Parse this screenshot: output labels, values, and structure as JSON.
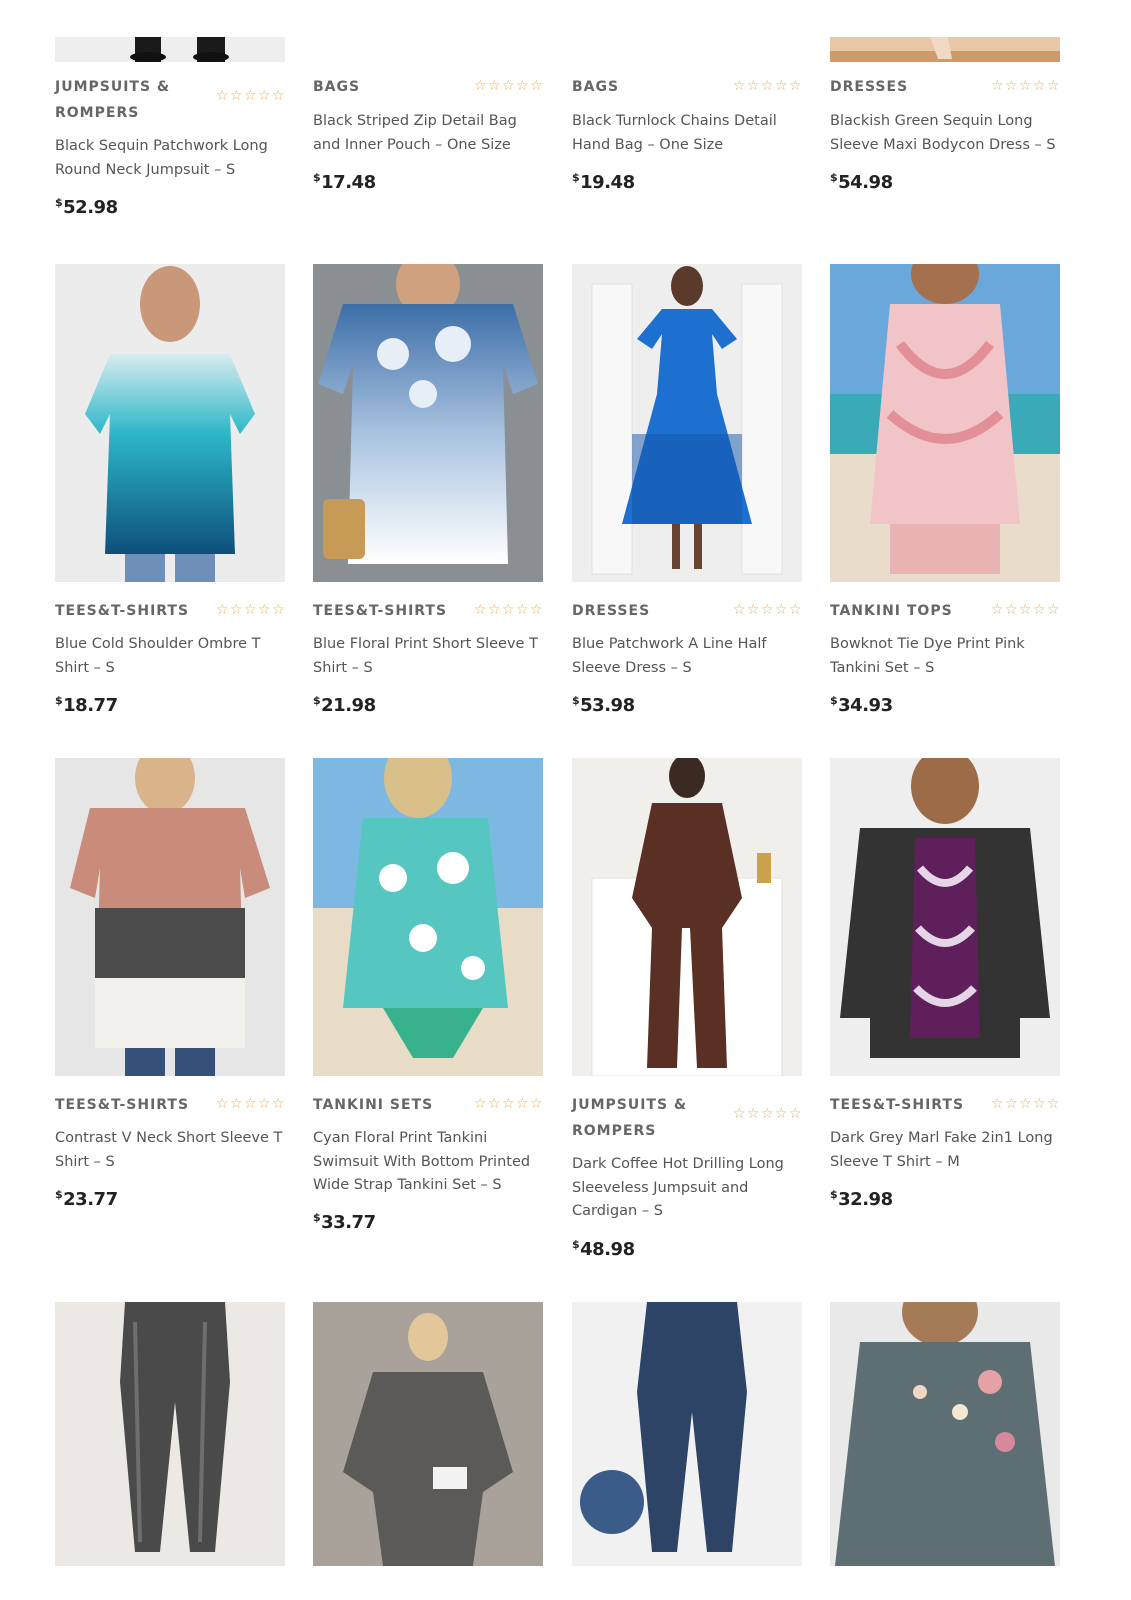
{
  "products": [
    {
      "category": "JUMPSUITS & ROMPERS",
      "title": "Black Sequin Patchwork Long Round Neck Jumpsuit – S",
      "currency": "$",
      "price": "52.98",
      "image": "black-jumpsuit-image",
      "image_color": "#2a2a2a"
    },
    {
      "category": "BAGS",
      "title": "Black Striped Zip Detail Bag and Inner Pouch – One Size",
      "currency": "$",
      "price": "17.48",
      "image": "",
      "image_color": "#ffffff"
    },
    {
      "category": "BAGS",
      "title": "Black Turnlock Chains Detail Hand Bag – One Size",
      "currency": "$",
      "price": "19.48",
      "image": "",
      "image_color": "#ffffff"
    },
    {
      "category": "DRESSES",
      "title": "Blackish Green Sequin Long Sleeve Maxi Bodycon Dress – S",
      "currency": "$",
      "price": "54.98",
      "image": "dress-photo-image",
      "image_color": "#d6a27a"
    },
    {
      "category": "TEES&T-SHIRTS",
      "title": "Blue Cold Shoulder Ombre T Shirt – S",
      "currency": "$",
      "price": "18.77",
      "image": "ombre-tshirt-image",
      "image_color": "#1f8fb0"
    },
    {
      "category": "TEES&T-SHIRTS",
      "title": "Blue Floral Print Short Sleeve T Shirt – S",
      "currency": "$",
      "price": "21.98",
      "image": "floral-tshirt-image",
      "image_color": "#4f79b0"
    },
    {
      "category": "DRESSES",
      "title": "Blue Patchwork A Line Half Sleeve Dress – S",
      "currency": "$",
      "price": "53.98",
      "image": "blue-dress-image",
      "image_color": "#1d6fd0"
    },
    {
      "category": "TANKINI TOPS",
      "title": "Bowknot Tie Dye Print Pink Tankini Set – S",
      "currency": "$",
      "price": "34.93",
      "image": "pink-tankini-image",
      "image_color": "#e8a3a8"
    },
    {
      "category": "TEES&T-SHIRTS",
      "title": "Contrast V Neck Short Sleeve T Shirt – S",
      "currency": "$",
      "price": "23.77",
      "image": "contrast-tshirt-image",
      "image_color": "#c98b7a"
    },
    {
      "category": "TANKINI SETS",
      "title": "Cyan Floral Print Tankini Swimsuit With Bottom Printed Wide Strap Tankini Set – S",
      "currency": "$",
      "price": "33.77",
      "image": "cyan-tankini-image",
      "image_color": "#55c6c0"
    },
    {
      "category": "JUMPSUITS & ROMPERS",
      "title": "Dark Coffee Hot Drilling Long Sleeveless Jumpsuit and Cardigan – S",
      "currency": "$",
      "price": "48.98",
      "image": "coffee-jumpsuit-image",
      "image_color": "#5a3024"
    },
    {
      "category": "TEES&T-SHIRTS",
      "title": "Dark Grey Marl Fake 2in1 Long Sleeve T Shirt – M",
      "currency": "$",
      "price": "32.98",
      "image": "grey-marl-tshirt-image",
      "image_color": "#3a3a3a"
    },
    {
      "category": "",
      "title": "",
      "currency": "",
      "price": "",
      "image": "grey-leggings-image",
      "image_color": "#4a4a4a"
    },
    {
      "category": "",
      "title": "",
      "currency": "",
      "price": "",
      "image": "grey-outfit-image",
      "image_color": "#5c5a58"
    },
    {
      "category": "",
      "title": "",
      "currency": "",
      "price": "",
      "image": "denim-leggings-image",
      "image_color": "#2e4466"
    },
    {
      "category": "",
      "title": "",
      "currency": "",
      "price": "",
      "image": "floral-longsleeve-image",
      "image_color": "#5d6f72"
    }
  ],
  "rating_icon": "star-outline-icon",
  "rating_color": "#e8b04a",
  "rating_stars": 5
}
